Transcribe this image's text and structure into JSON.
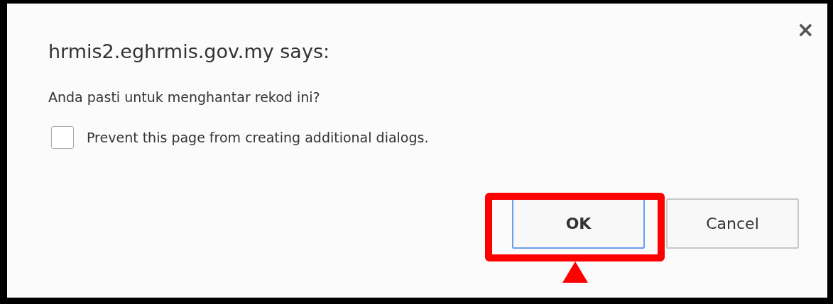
{
  "dialog": {
    "title": "hrmis2.eghrmis.gov.my says:",
    "close": "×",
    "message": "Anda pasti untuk menghantar rekod ini?",
    "checkbox": {
      "label": "Prevent this page from creating additional dialogs.",
      "checked": false
    },
    "buttons": [
      {
        "label": "OK",
        "focused": true,
        "highlighted": true
      },
      {
        "label": "Cancel",
        "focused": false,
        "highlighted": false
      }
    ]
  }
}
